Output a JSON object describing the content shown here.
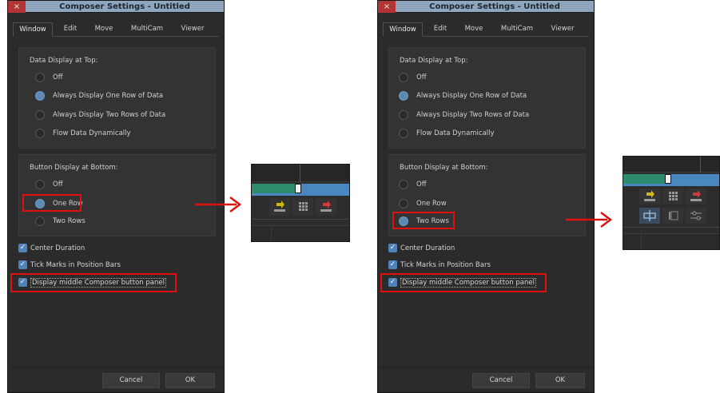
{
  "colors": {
    "title_bar": "#8ea6bd",
    "close": "#b33434",
    "panel": "#2b2b2b",
    "group": "#333333",
    "radio_selected": "#5d8ab4",
    "checkbox": "#4f82b8",
    "highlight": "#e01010",
    "timeline_green": "#2e8b6e",
    "timeline_blue": "#4a86c0"
  },
  "left": {
    "title": "Composer Settings - Untitled",
    "close": "×",
    "tabs": [
      "Window",
      "Edit",
      "Move",
      "MultiCam",
      "Viewer"
    ],
    "data_display_title": "Data Display at Top:",
    "data_options": [
      "Off",
      "Always Display One Row of Data",
      "Always Display Two Rows of Data",
      "Flow Data Dynamically"
    ],
    "data_selected": 1,
    "button_display_title": "Button Display at Bottom:",
    "button_options": [
      "Off",
      "One Row",
      "Two Rows"
    ],
    "button_selected": 1,
    "checks": [
      "Center Duration",
      "Tick Marks in Position Bars",
      "Display middle Composer button panel"
    ],
    "cancel": "Cancel",
    "ok": "OK"
  },
  "right": {
    "title": "Composer Settings - Untitled",
    "close": "×",
    "tabs": [
      "Window",
      "Edit",
      "Move",
      "MultiCam",
      "Viewer"
    ],
    "data_display_title": "Data Display at Top:",
    "data_options": [
      "Off",
      "Always Display One Row of Data",
      "Always Display Two Rows of Data",
      "Flow Data Dynamically"
    ],
    "data_selected": 1,
    "button_display_title": "Button Display at Bottom:",
    "button_options": [
      "Off",
      "One Row",
      "Two Rows"
    ],
    "button_selected": 2,
    "checks": [
      "Center Duration",
      "Tick Marks in Position Bars",
      "Display middle Composer button panel"
    ],
    "cancel": "Cancel",
    "ok": "OK"
  },
  "preview_icons": [
    "splice-in-icon",
    "grid-icon",
    "lift-icon",
    "overwrite-icon",
    "multicam-icon",
    "mixer-icon"
  ]
}
